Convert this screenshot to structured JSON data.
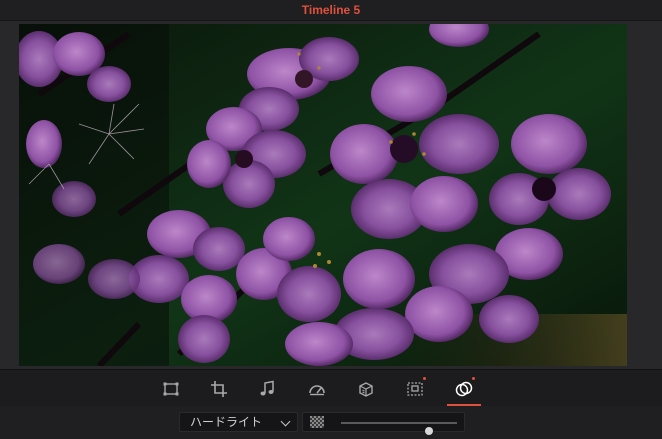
{
  "window": {
    "title": "Timeline 5"
  },
  "colors": {
    "title": "#e0513d",
    "active": "#e0513d",
    "icon": "#a9a9a9",
    "active_icon": "#ffffff"
  },
  "toolbar": {
    "tools": [
      {
        "name": "transform-icon",
        "badge": false,
        "active": false
      },
      {
        "name": "crop-icon",
        "badge": false,
        "active": false
      },
      {
        "name": "audio-icon",
        "badge": false,
        "active": false
      },
      {
        "name": "speed-icon",
        "badge": false,
        "active": false
      },
      {
        "name": "stabilization-icon",
        "badge": false,
        "active": false
      },
      {
        "name": "dynamic-zoom-icon",
        "badge": true,
        "active": false
      },
      {
        "name": "composite-icon",
        "badge": true,
        "active": true
      }
    ]
  },
  "composite": {
    "mode": "ハードライト",
    "opacity": 0.76
  }
}
